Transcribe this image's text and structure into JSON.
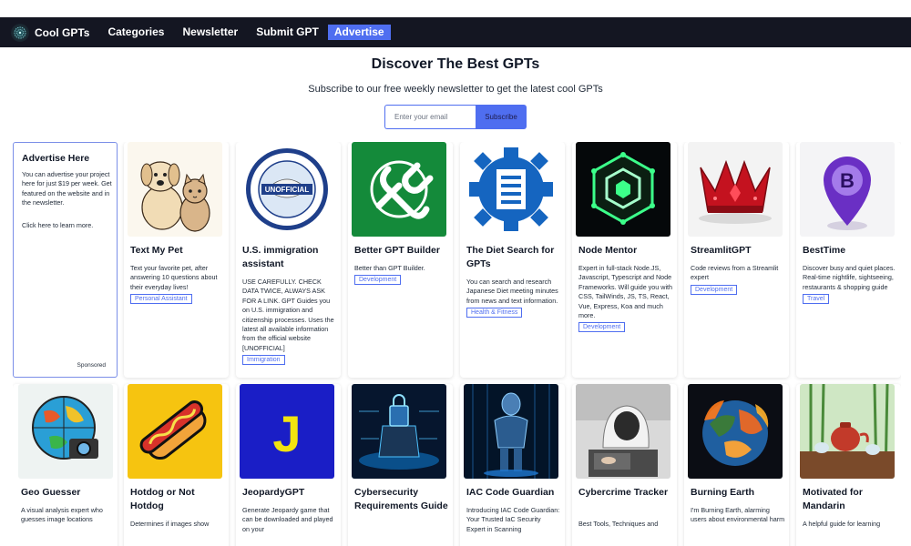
{
  "nav": {
    "brand": "Cool GPTs",
    "links": [
      "Categories",
      "Newsletter",
      "Submit GPT"
    ],
    "advertise": "Advertise"
  },
  "hero": {
    "title": "Discover The Best GPTs",
    "subtitle": "Subscribe to our free weekly newsletter to get the latest cool GPTs",
    "email_placeholder": "Enter your email",
    "subscribe_label": "Subscribe"
  },
  "ad": {
    "title": "Advertise Here",
    "text": "You can advertise your project here for just $19 per week. Get featured on the website and in the newsletter.",
    "link": "Click here to learn more.",
    "sponsored": "Sponsored"
  },
  "cards_row1": [
    {
      "title": "Text My Pet",
      "desc": "Text your favorite pet, after answering 10 questions about their everyday lives!",
      "tag": "Personal Assistant",
      "icon": "pet-illustration-icon"
    },
    {
      "title": "U.S. immigration assistant",
      "desc": "USE CAREFULLY. CHECK DATA TWICE, ALWAYS ASK FOR A LINK. GPT Guides you on U.S. immigration and citizenship processes. Uses the latest all available information from the official website [UNOFFICIAL]",
      "tag": "Immigration",
      "icon": "homeland-security-seal-icon",
      "seal_text": "UNOFFICIAL"
    },
    {
      "title": "Better GPT Builder",
      "desc": "Better than GPT Builder.",
      "tag": "Development",
      "icon": "tools-logo-icon"
    },
    {
      "title": "The Diet Search for GPTs",
      "desc": "You can search and research Japanese Diet meeting minutes from news and text information.",
      "tag": "Health & Fitness",
      "icon": "gear-document-icon"
    },
    {
      "title": "Node Mentor",
      "desc": "Expert in full-stack Node.JS, Javascript, Typescript and Node Frameworks. Will guide you with CSS, TailWinds, JS, TS, React, Vue, Express, Koa and much more.",
      "tag": "Development",
      "icon": "hexagon-node-icon"
    },
    {
      "title": "StreamlitGPT",
      "desc": "Code reviews from a Streamlit expert",
      "tag": "Development",
      "icon": "crown-icon"
    },
    {
      "title": "BestTime",
      "desc": "Discover busy and quiet places. Real-time nightlife, sightseeing, restaurants & shopping guide",
      "tag": "Travel",
      "icon": "map-pin-b-icon",
      "pin_letter": "B"
    }
  ],
  "cards_row2": [
    {
      "title": "Geo Guesser",
      "desc": "A visual analysis expert who guesses image locations",
      "icon": "globe-camera-icon"
    },
    {
      "title": "Hotdog or Not Hotdog",
      "desc": "Determines if images show",
      "icon": "hotdog-icon"
    },
    {
      "title": "JeopardyGPT",
      "desc": "Generate Jeopardy game that can be downloaded and played on your",
      "icon": "letter-j-icon",
      "letter": "J"
    },
    {
      "title": "Cybersecurity Requirements Guide",
      "desc": "",
      "icon": "cyber-lock-icon"
    },
    {
      "title": "IAC Code Guardian",
      "desc": "Introducing IAC Code Guardian: Your Trusted IaC Security Expert in Scanning",
      "icon": "robot-guardian-icon"
    },
    {
      "title": "Cybercrime Tracker",
      "desc": "Best Tools, Techniques and",
      "icon": "hacker-icon"
    },
    {
      "title": "Burning Earth",
      "desc": "I'm Burning Earth, alarming users about environmental harm",
      "icon": "burning-earth-icon"
    },
    {
      "title": "Motivated for Mandarin",
      "desc": "A helpful guide for learning",
      "icon": "tea-set-icon"
    }
  ]
}
